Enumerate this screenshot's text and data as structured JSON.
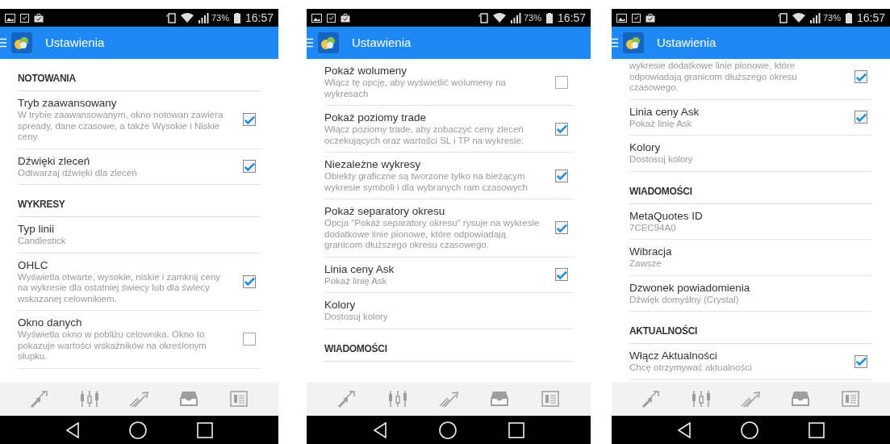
{
  "screens": [
    {
      "status_bar": {
        "battery": "73%",
        "time": "16:57"
      },
      "title": "Ustawienia",
      "list": [
        {
          "kind": "header",
          "label": "NOTOWANIA"
        },
        {
          "kind": "check",
          "title": "Tryb zaawansowany",
          "summary": "W trybie zaawansowanym, okno notowan zawiera spready, dane czasowe, a także Wysokie i Niskie ceny.",
          "checked": true
        },
        {
          "kind": "check",
          "title": "Dźwięki zleceń",
          "summary": "Odtwarzaj dźwięki dla zleceń",
          "checked": true
        },
        {
          "kind": "header",
          "label": "WYKRESY"
        },
        {
          "kind": "plain",
          "title": "Typ linii",
          "summary": "Candlestick"
        },
        {
          "kind": "check",
          "title": "OHLC",
          "summary": "Wyświetla otwarte, wysokie, niskie i zamknij ceny na wykresie dla ostatniej świecy lub dla świecy wskazanej celownikiem.",
          "checked": true
        },
        {
          "kind": "check",
          "title": "Okno danych",
          "summary": "Wyświetla okno w pobliżu celownika. Okno to pokazuje wartości wskaźników na określonym słupku.",
          "checked": false
        }
      ]
    },
    {
      "status_bar": {
        "battery": "73%",
        "time": "16:57"
      },
      "title": "Ustawienia",
      "list": [
        {
          "kind": "check",
          "title": "Pokaż wolumeny",
          "summary": "Włącz tę opcję, aby wyświetlić wolumeny na wykresach",
          "checked": false
        },
        {
          "kind": "check",
          "title": "Pokaż poziomy trade",
          "summary": "Włącz poziomy trade, aby zobaczyć ceny zleceń oczekujących oraz wartości SL i TP na wykresie.",
          "checked": true
        },
        {
          "kind": "check",
          "title": "Niezależne wykresy",
          "summary": "Obiekty graficzne są tworzone tylko na bieżącym wykresie symboli i dla wybranych ram czasowych",
          "checked": true
        },
        {
          "kind": "check",
          "title": "Pokaż separatory okresu",
          "summary": "Opcja \"Pokaż separatory okresu\" rysuje na wykresie dodatkowe linie pionowe, które odpowiadają granicom dłuższego okresu czasowego.",
          "checked": true
        },
        {
          "kind": "check",
          "title": "Linia ceny Ask",
          "summary": "Pokaż linię Ask",
          "checked": true
        },
        {
          "kind": "plain",
          "title": "Kolory",
          "summary": "Dostosuj kolory"
        },
        {
          "kind": "header",
          "label": "WIADOMOŚCI"
        }
      ]
    },
    {
      "status_bar": {
        "battery": "73%",
        "time": "16:57"
      },
      "title": "Ustawienia",
      "list": [
        {
          "kind": "check",
          "summary": "wykresie dodatkowe linie pionowe, które odpowiadają granicom dłuższego okresu czasowego.",
          "checked": true
        },
        {
          "kind": "check",
          "title": "Linia ceny Ask",
          "summary": "Pokaż linię Ask",
          "checked": true
        },
        {
          "kind": "plain",
          "title": "Kolory",
          "summary": "Dostosuj kolory"
        },
        {
          "kind": "header",
          "label": "WIADOMOŚCI"
        },
        {
          "kind": "plain",
          "title": "MetaQuotes ID",
          "summary": "7CEC94A0"
        },
        {
          "kind": "plain",
          "title": "Wibracja",
          "summary": "Zawsze"
        },
        {
          "kind": "plain",
          "title": "Dzwonek powiadomienia",
          "summary": "Dźwięk domyślny (Crystal)"
        },
        {
          "kind": "header",
          "label": "AKTUALNOŚCI"
        },
        {
          "kind": "check",
          "title": "Włącz Aktualności",
          "summary": "Chcę otrzymywać aktualności",
          "checked": true
        }
      ]
    }
  ]
}
